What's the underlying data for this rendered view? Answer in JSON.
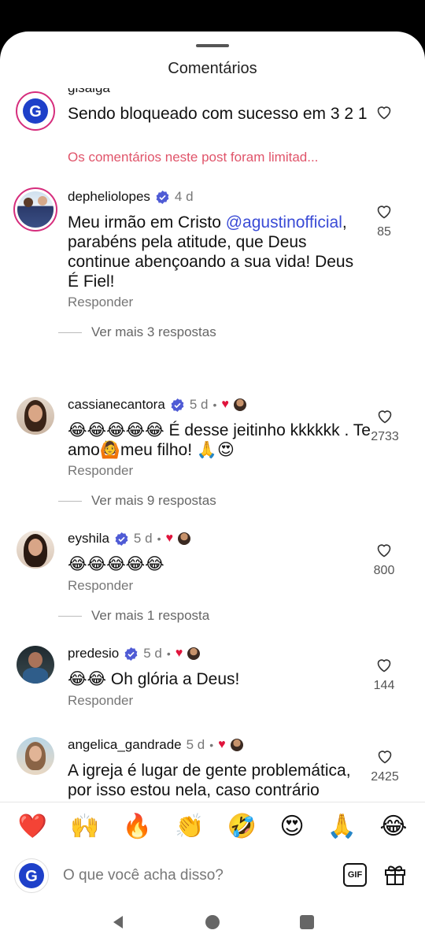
{
  "header": {
    "title": "Comentários"
  },
  "comments": [
    {
      "username": "gisaiga",
      "text": "Sendo bloqueado com sucesso em 3 2 1",
      "limited_notice": "Os comentários neste post foram limitad..."
    },
    {
      "username": "depheliolopes",
      "time": "4 d",
      "text_before": "Meu irmão em Cristo ",
      "mention": "@agustinofficial",
      "text_after": ", parabéns pela atitude, que Deus continue abençoando a sua vida! Deus É Fiel!",
      "like_count": "85",
      "reply_label": "Responder",
      "more_replies": "Ver mais 3 respostas"
    },
    {
      "username": "cassianecantora",
      "time": "5 d",
      "text": "😂😂😂😂😂 É desse jeitinho kkkkkk . Te amo🙆meu filho! 🙏😍",
      "like_count": "2733",
      "reply_label": "Responder",
      "more_replies": "Ver mais 9 respostas"
    },
    {
      "username": "eyshila",
      "time": "5 d",
      "text": "😂😂😂😂😂",
      "like_count": "800",
      "reply_label": "Responder",
      "more_replies": "Ver mais 1 resposta"
    },
    {
      "username": "predesio",
      "time": "5 d",
      "text": "😂😂 Oh glória a Deus!",
      "like_count": "144",
      "reply_label": "Responder"
    },
    {
      "username": "angelica_gandrade",
      "time": "5 d",
      "text": "A igreja é lugar de gente problemática, por isso estou nela, caso contrário estaria levando problemas para a vida de outras pessoas 🙌😂",
      "like_count": "2425"
    }
  ],
  "emoji_bar": [
    "❤️",
    "🙌",
    "🔥",
    "👏",
    "🤣",
    "😍",
    "🙏",
    "😂"
  ],
  "composer": {
    "placeholder": "O que você acha disso?",
    "gif_label": "GIF",
    "avatar_letter": "G"
  },
  "colors": {
    "mention": "#3a4bd6",
    "limited": "#e0546a",
    "verified": "#4f5bd5",
    "story_ring": "#d62e7d"
  }
}
